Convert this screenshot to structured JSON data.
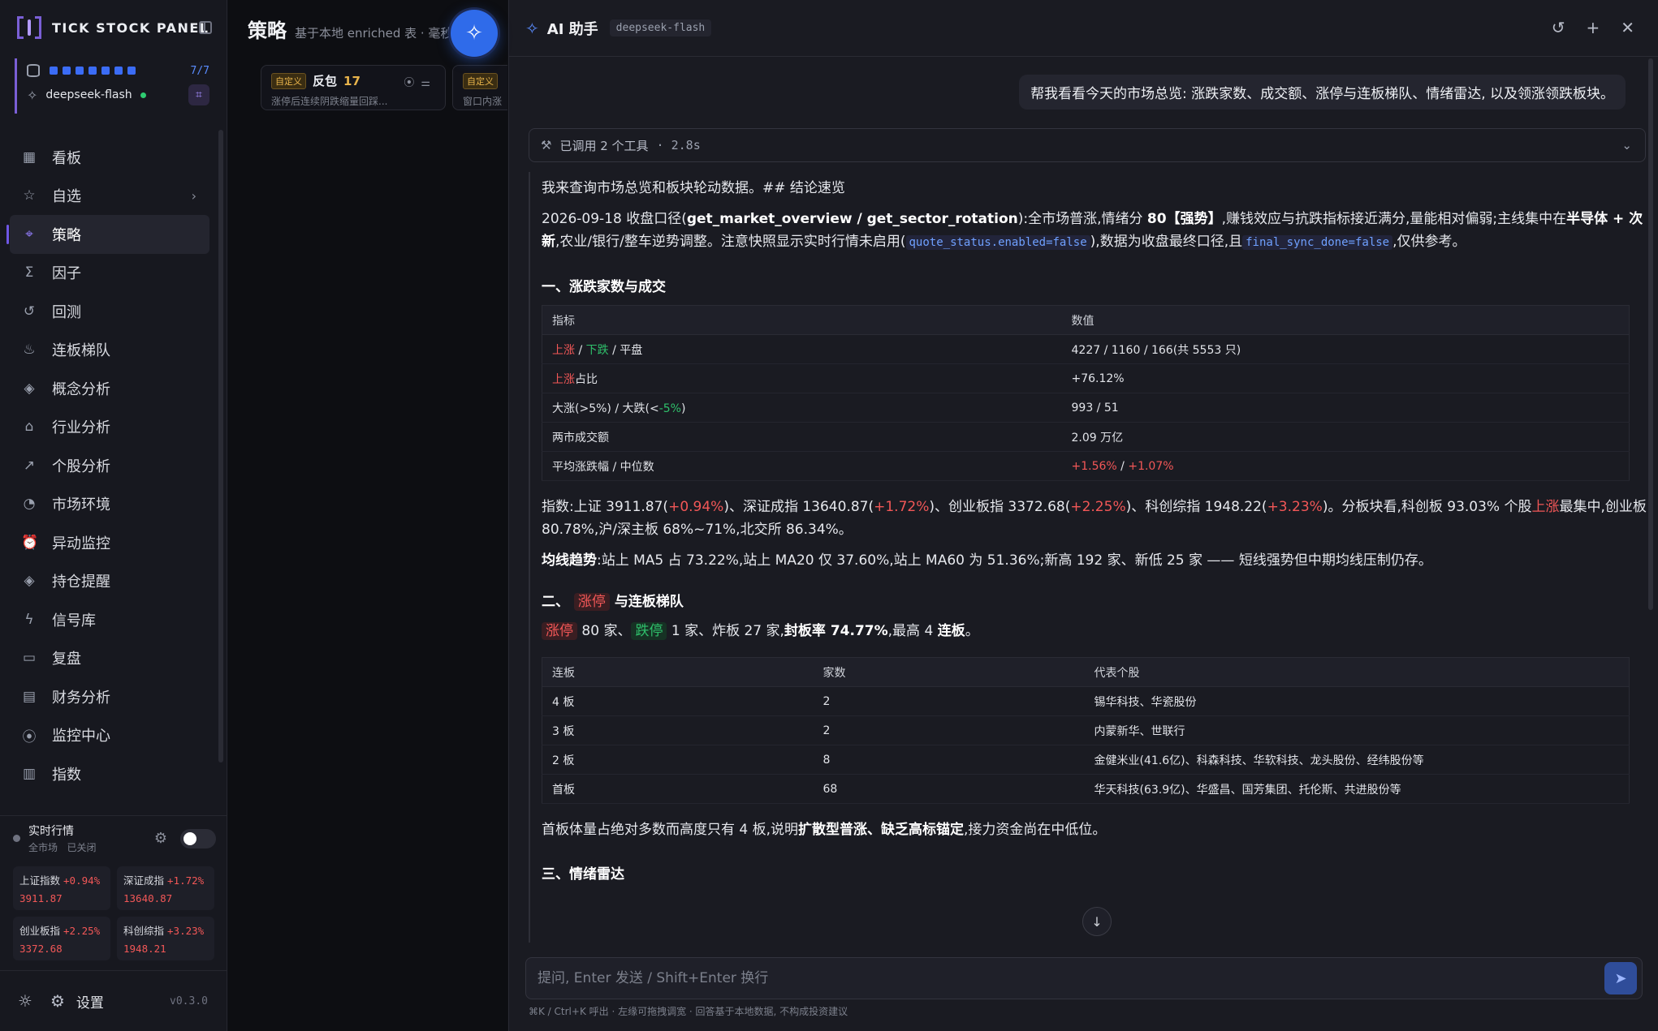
{
  "sidebar": {
    "brand": "TICK STOCK PANEL",
    "status": {
      "ratio": "7/7",
      "model": "deepseek-flash"
    },
    "items": [
      {
        "label": "看板",
        "icon": "grid-icon"
      },
      {
        "label": "自选",
        "icon": "star-icon"
      },
      {
        "label": "策略",
        "icon": "scan-icon"
      },
      {
        "label": "因子",
        "icon": "sigma-icon"
      },
      {
        "label": "回测",
        "icon": "history-icon"
      },
      {
        "label": "连板梯队",
        "icon": "flame-icon"
      },
      {
        "label": "概念分析",
        "icon": "layers-icon"
      },
      {
        "label": "行业分析",
        "icon": "bank-icon"
      },
      {
        "label": "个股分析",
        "icon": "trend-icon"
      },
      {
        "label": "市场环境",
        "icon": "gauge-icon"
      },
      {
        "label": "异动监控",
        "icon": "alarm-icon"
      },
      {
        "label": "持仓提醒",
        "icon": "layers-icon"
      },
      {
        "label": "信号库",
        "icon": "bolt-icon"
      },
      {
        "label": "复盘",
        "icon": "book-icon"
      },
      {
        "label": "财务分析",
        "icon": "document-icon"
      },
      {
        "label": "监控中心",
        "icon": "radio-icon"
      },
      {
        "label": "指数",
        "icon": "bar-chart-icon"
      }
    ],
    "realtime": {
      "title": "实时行情",
      "sub_scope": "全市场",
      "sub_state": "已关闭",
      "indices": [
        {
          "name": "上证指数",
          "chg": "+0.94%",
          "value": "3911.87"
        },
        {
          "name": "深证成指",
          "chg": "+1.72%",
          "value": "13640.87"
        },
        {
          "name": "创业板指",
          "chg": "+2.25%",
          "value": "3372.68"
        },
        {
          "name": "科创综指",
          "chg": "+3.23%",
          "value": "1948.21"
        }
      ]
    },
    "settings_label": "设置",
    "version": "v0.3.0"
  },
  "middle": {
    "title": "策略",
    "subtitle": "基于本地 enriched 表 · 毫秒级",
    "cards": [
      {
        "tag": "自定义",
        "name": "反包",
        "count": "17",
        "desc": "涨停后连续阴跌缩量回踩..."
      },
      {
        "tag": "自定义",
        "name": "",
        "count": "",
        "desc": "窗口内涨"
      }
    ]
  },
  "assistant": {
    "title": "AI 助手",
    "model": "deepseek-flash",
    "user_message": "帮我看看今天的市场总览: 涨跌家数、成交额、涨停与连板梯队、情绪雷达, 以及领涨领跌板块。",
    "tools": {
      "label": "已调用 2 个工具",
      "time": "· 2.8s"
    },
    "answer": {
      "intro": "我来查询市场总览和板块轮动数据。## 结论速览",
      "summary": {
        "a": "2026-09-18 收盘口径(",
        "b": "get_market_overview / get_sector_rotation",
        "c": "):全市场普涨,情绪分 ",
        "d": "80【强势】",
        "e": ",赚钱效应与抗跌指标接近满分,量能相对偏弱;主线集中在",
        "f": "半导体 + 次新",
        "g": ",农业/银行/整车逆势调整。注意快照显示实时行情未启用(",
        "h": "quote_status.enabled=false",
        "i": "),数据为收盘最终口径,且",
        "j": "final_sync_done=false",
        "k": ",仅供参考。"
      },
      "section1": "一、涨跌家数与成交",
      "table1": {
        "headers": [
          "指标",
          "数值"
        ],
        "r1_a": "上涨",
        "r1_b": " / ",
        "r1_c": "下跌",
        "r1_d": " / 平盘",
        "r1_v": "4227 / 1160 / 166(共 5553 只)",
        "r2_a": "上涨",
        "r2_b": "占比",
        "r2_v": "+76.12%",
        "r3_a": "大涨(>5%) / 大跌(<",
        "r3_b": "-5%",
        "r3_c": ")",
        "r3_v": "993 / 51",
        "r4_a": "两市成交额",
        "r4_v": "2.09 万亿",
        "r5_a": "平均涨跌幅 / 中位数",
        "r5_v1": "+1.56%",
        "r5_v2": " / ",
        "r5_v3": "+1.07%"
      },
      "indices_para": {
        "a": "指数:上证 3911.87(",
        "b": "+0.94%",
        "c": ")、深证成指 13640.87(",
        "d": "+1.72%",
        "e": ")、创业板指 3372.68(",
        "f": "+2.25%",
        "g": ")、科创综指 1948.22(",
        "h": "+3.23%",
        "i": ")。分板块看,科创板 93.03% 个股",
        "j": "上涨",
        "k": "最集中,创业板 80.78%,沪/深主板 68%~71%,北交所 86.34%。"
      },
      "ma_para": {
        "a": "均线趋势",
        "b": ":站上 MA5 占 73.22%,站上 MA20 仅 37.60%,站上 MA60 为 51.36%;新高 192 家、新低 25 家 —— 短线强势但中期均线压制仍存。"
      },
      "section2": {
        "a": "二、",
        "b": "涨停",
        "c": "与连板梯队"
      },
      "limit_para": {
        "a": "涨停",
        "b": " 80 家、",
        "c": "跌停",
        "d": " 1 家、炸板 27 家,",
        "e": "封板率 74.77%",
        "f": ",最高 4 ",
        "g": "连板",
        "h": "。"
      },
      "table2": {
        "headers": [
          "连板",
          "家数",
          "代表个股"
        ],
        "rows": [
          [
            "4 板",
            "2",
            "锡华科技、华瓷股份"
          ],
          [
            "3 板",
            "2",
            "内蒙新华、世联行"
          ],
          [
            "2 板",
            "8",
            "金健米业(41.6亿)、科森科技、华软科技、龙头股份、经纬股份等"
          ],
          [
            "首板",
            "68",
            "华天科技(63.9亿)、华盛昌、国芳集团、托伦斯、共进股份等"
          ]
        ]
      },
      "first_board_para": {
        "a": "首板体量占绝对多数而高度只有 4 板,说明",
        "b": "扩散型普涨、缺乏高标锚定",
        "c": ",接力资金尚在中低位。"
      },
      "section3": "三、情绪雷达"
    },
    "input_placeholder": "提问, Enter 发送 / Shift+Enter 换行",
    "hint": "⌘K / Ctrl+K 呼出 · 左缘可拖拽调宽 · 回答基于本地数据, 不构成投资建议"
  }
}
